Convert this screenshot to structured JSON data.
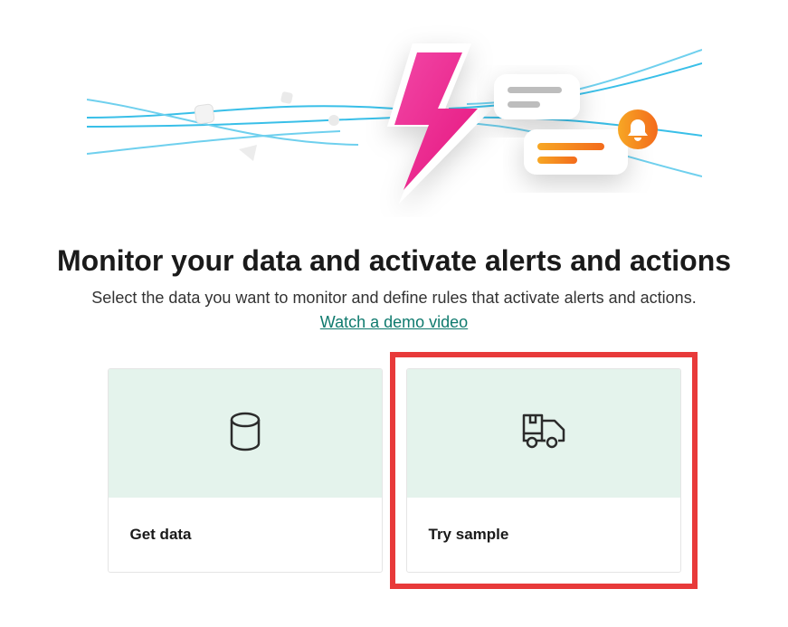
{
  "heading": "Monitor your data and activate alerts and actions",
  "subtext": "Select the data you want to monitor and define rules that activate alerts and actions.",
  "demoLink": "Watch a demo video",
  "cards": {
    "getData": {
      "label": "Get data"
    },
    "trySample": {
      "label": "Try sample"
    }
  }
}
